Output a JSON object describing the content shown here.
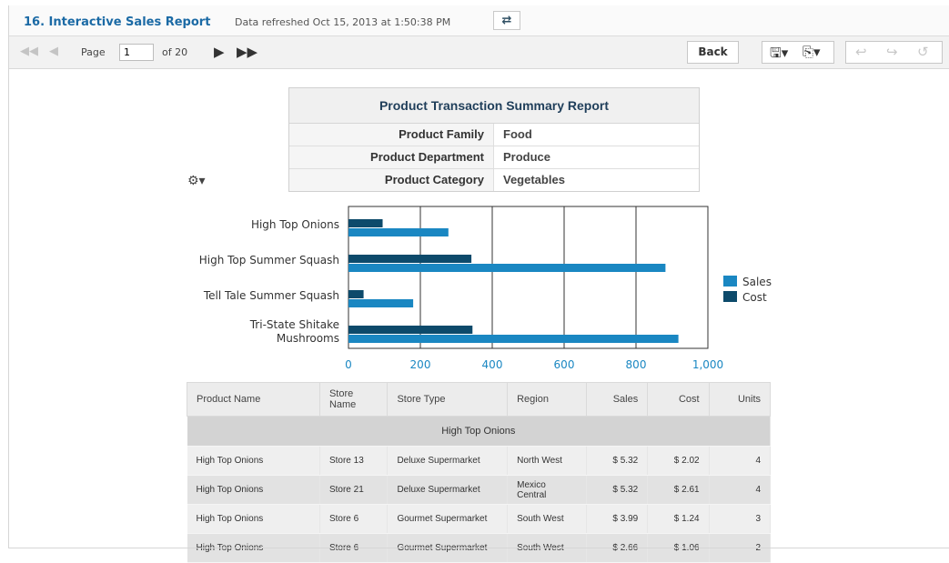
{
  "header": {
    "title": "16. Interactive Sales Report",
    "refreshed": "Data refreshed Oct 15, 2013 at 1:50:38 PM",
    "refresh_icon": "refresh-arrows-icon"
  },
  "toolbar": {
    "page_label": "Page",
    "page_value": "1",
    "of_label": "of 20",
    "back_label": "Back",
    "icons": [
      "first-page-icon",
      "prev-page-icon",
      "next-page-icon",
      "last-page-icon",
      "save-icon",
      "export-icon",
      "undo-icon",
      "redo-icon",
      "reset-icon"
    ]
  },
  "summary": {
    "title": "Product Transaction Summary Report",
    "rows": [
      {
        "label": "Product Family",
        "value": "Food"
      },
      {
        "label": "Product Department",
        "value": "Produce"
      },
      {
        "label": "Product Category",
        "value": "Vegetables"
      }
    ]
  },
  "chart_data": {
    "type": "bar",
    "orientation": "horizontal",
    "categories": [
      "High Top Onions",
      "High Top Summer Squash",
      "Tell Tale Summer Squash",
      "Tri-State Shitake Mushrooms"
    ],
    "series": [
      {
        "name": "Cost",
        "color": "#0d4a6b",
        "values": [
          95,
          342,
          42,
          345
        ]
      },
      {
        "name": "Sales",
        "color": "#1a87c2",
        "values": [
          278,
          882,
          180,
          918
        ]
      }
    ],
    "xlim": [
      0,
      1000
    ],
    "xticks": [
      "0",
      "200",
      "400",
      "600",
      "800",
      "1,000"
    ],
    "legend": [
      "Sales",
      "Cost"
    ],
    "legend_position": "right",
    "grid": true
  },
  "table": {
    "headers": [
      "Product Name",
      "Store Name",
      "Store Type",
      "Region",
      "Sales",
      "Cost",
      "Units"
    ],
    "group": "High Top Onions",
    "rows": [
      [
        "High Top Onions",
        "Store 13",
        "Deluxe Supermarket",
        "North West",
        "$ 5.32",
        "$ 2.02",
        "4"
      ],
      [
        "High Top Onions",
        "Store 21",
        "Deluxe Supermarket",
        "Mexico Central",
        "$ 5.32",
        "$ 2.61",
        "4"
      ],
      [
        "High Top Onions",
        "Store 6",
        "Gourmet Supermarket",
        "South West",
        "$ 3.99",
        "$ 1.24",
        "3"
      ],
      [
        "High Top Onions",
        "Store 6",
        "Gourmet Supermarket",
        "South West",
        "$ 2.66",
        "$ 1.06",
        "2"
      ]
    ]
  }
}
